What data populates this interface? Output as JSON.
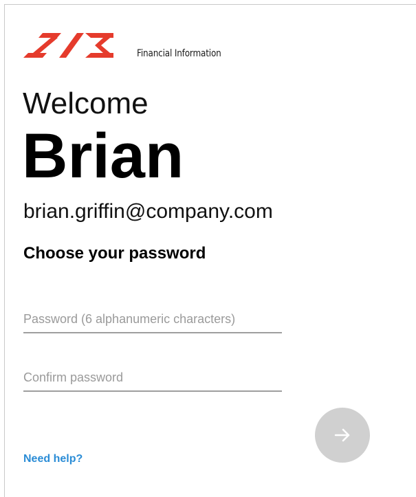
{
  "brand": {
    "logo_text": "SIX",
    "subtitle": "Financial Information",
    "color": "#e53b2c"
  },
  "welcome": {
    "greeting": "Welcome",
    "name": "Brian",
    "email": "brian.griffin@company.com"
  },
  "form": {
    "title": "Choose your password",
    "password": {
      "value": "",
      "placeholder": "Password (6 alphanumeric characters)"
    },
    "confirm": {
      "value": "",
      "placeholder": "Confirm password"
    },
    "submit_icon": "arrow-right-icon",
    "submit_color": "#d0d0d0"
  },
  "help": {
    "label": "Need help?",
    "color": "#2a8cd6"
  }
}
